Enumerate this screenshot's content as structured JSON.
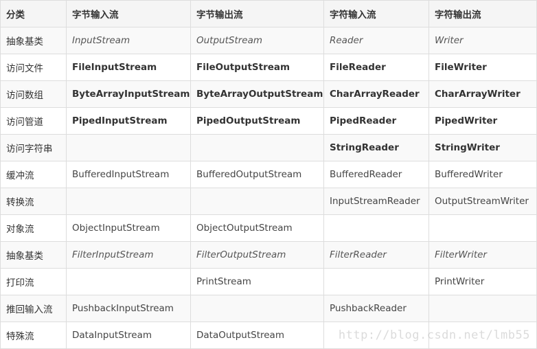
{
  "table": {
    "headers": [
      "分类",
      "字节输入流",
      "字节输出流",
      "字符输入流",
      "字符输出流"
    ],
    "rows": [
      {
        "style": "italic",
        "cells": [
          "抽象基类",
          "InputStream",
          "OutputStream",
          "Reader",
          "Writer"
        ]
      },
      {
        "style": "bold",
        "cells": [
          "访问文件",
          "FileInputStream",
          "FileOutputStream",
          "FileReader",
          "FileWriter"
        ]
      },
      {
        "style": "bold",
        "cells": [
          "访问数组",
          "ByteArrayInputStream",
          "ByteArrayOutputStream",
          "CharArrayReader",
          "CharArrayWriter"
        ]
      },
      {
        "style": "bold",
        "cells": [
          "访问管道",
          "PipedInputStream",
          "PipedOutputStream",
          "PipedReader",
          "PipedWriter"
        ]
      },
      {
        "style": "bold",
        "cells": [
          "访问字符串",
          "",
          "",
          "StringReader",
          "StringWriter"
        ]
      },
      {
        "style": "normal",
        "cells": [
          "缓冲流",
          "BufferedInputStream",
          "BufferedOutputStream",
          "BufferedReader",
          "BufferedWriter"
        ]
      },
      {
        "style": "normal",
        "cells": [
          "转换流",
          "",
          "",
          "InputStreamReader",
          "OutputStreamWriter"
        ]
      },
      {
        "style": "normal",
        "cells": [
          "对象流",
          "ObjectInputStream",
          "ObjectOutputStream",
          "",
          ""
        ]
      },
      {
        "style": "italic",
        "cells": [
          "抽象基类",
          "FilterInputStream",
          "FilterOutputStream",
          "FilterReader",
          "FilterWriter"
        ]
      },
      {
        "style": "normal",
        "cells": [
          "打印流",
          "",
          "PrintStream",
          "",
          "PrintWriter"
        ]
      },
      {
        "style": "normal",
        "cells": [
          "推回输入流",
          "PushbackInputStream",
          "",
          "PushbackReader",
          ""
        ]
      },
      {
        "style": "normal",
        "cells": [
          "特殊流",
          "DataInputStream",
          "DataOutputStream",
          "",
          ""
        ]
      }
    ]
  },
  "watermark": "http://blog.csdn.net/lmb55"
}
